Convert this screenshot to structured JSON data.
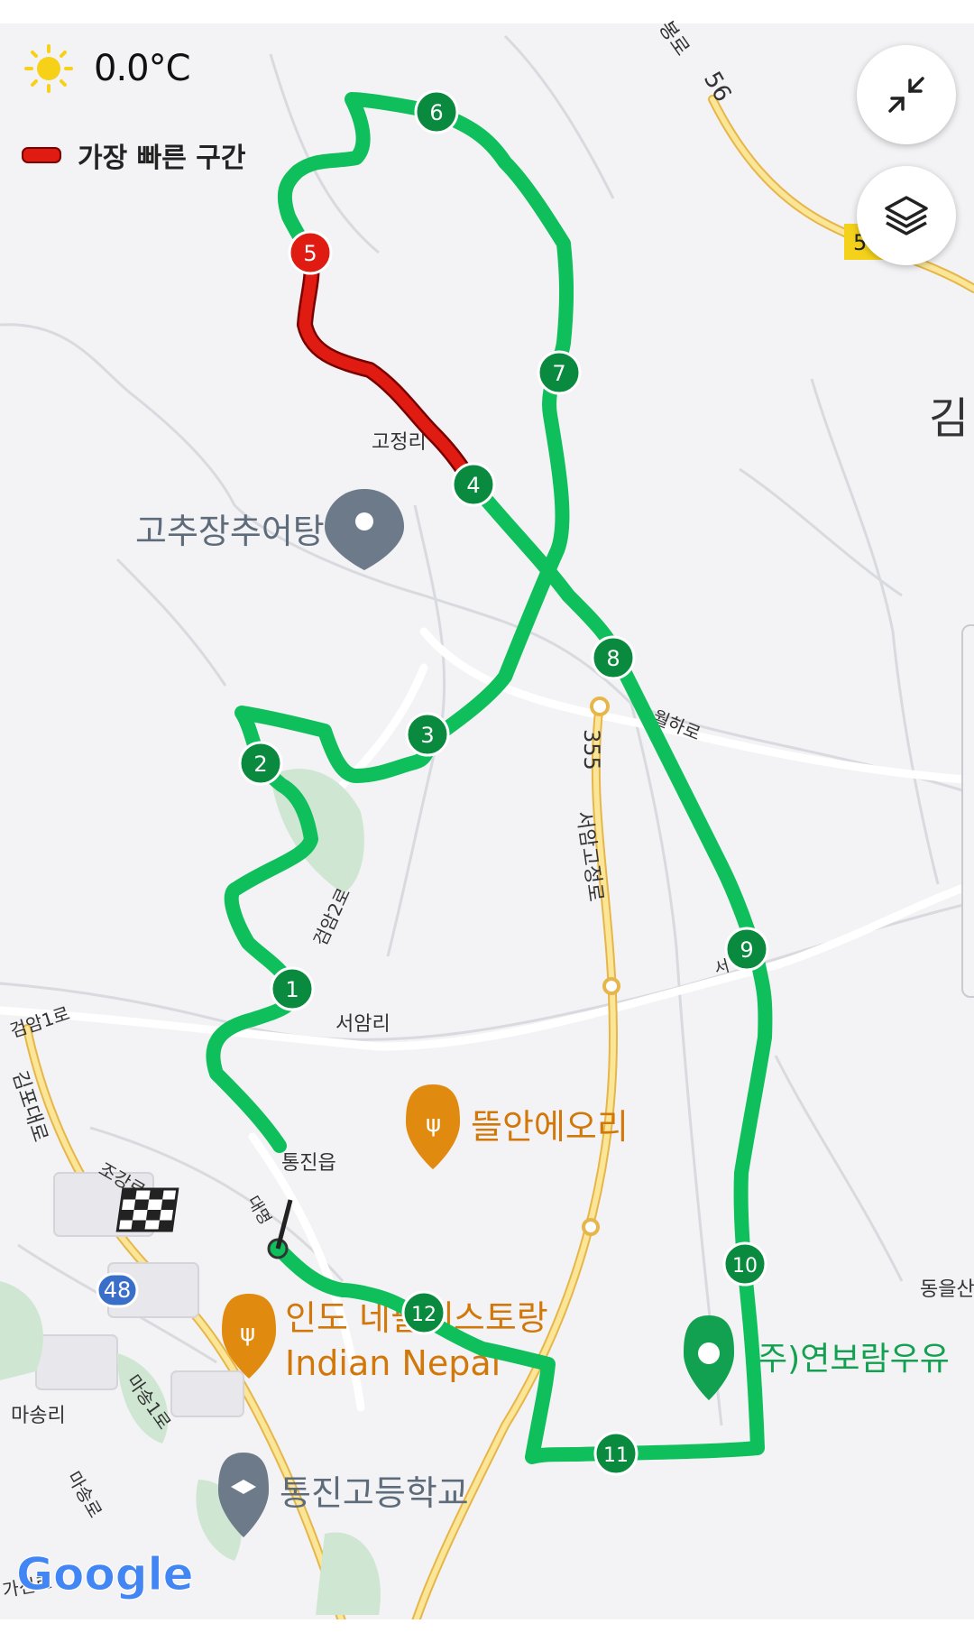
{
  "weather": {
    "icon": "sun-icon",
    "temperature": "0.0°C"
  },
  "legend": {
    "label": "가장 빠른 구간",
    "color": "#e01b12"
  },
  "controls": {
    "collapse_icon": "collapse-icon",
    "layers_icon": "layers-icon"
  },
  "colors": {
    "route": "#0fbf5c",
    "fastest": "#e01b12",
    "marker": "#0a8a3e",
    "poi_orange": "#e08a10",
    "poi_gray": "#6d7a8a"
  },
  "map": {
    "place_labels": {
      "gojeongri": "고정리",
      "seoamri": "서암리",
      "tongjineup": "통진읍",
      "masongri": "마송리",
      "dongeulsan": "동을산",
      "gim": "김",
      "road_gunam1": "검암1로",
      "road_gunam2": "검암2로",
      "road_gimpodaero": "김포대로",
      "road_joganglo": "조강로",
      "road_masong1": "마송1로",
      "road_masong": "마송로",
      "road_gaseon": "가선로",
      "road_wolharo": "월하로",
      "road_seoamgojeong": "서암고정로",
      "road_355": "355",
      "road_56": "56",
      "road_5x": "5",
      "road_48": "48",
      "road_bongro": "봉로",
      "road_daemyeong": "대명",
      "road_seo": "서"
    },
    "pois": {
      "gochujang": "고추장추어탕",
      "tteulan": "뜰안에오리",
      "indian1": "인도 네팔레스토랑",
      "indian2": "Indian Nepal",
      "yeonbo": "(주)연보람우유",
      "school": "통진고등학교"
    },
    "markers": [
      "1",
      "2",
      "3",
      "4",
      "5",
      "6",
      "7",
      "8",
      "9",
      "10",
      "11",
      "12"
    ],
    "google_logo": "Google"
  }
}
